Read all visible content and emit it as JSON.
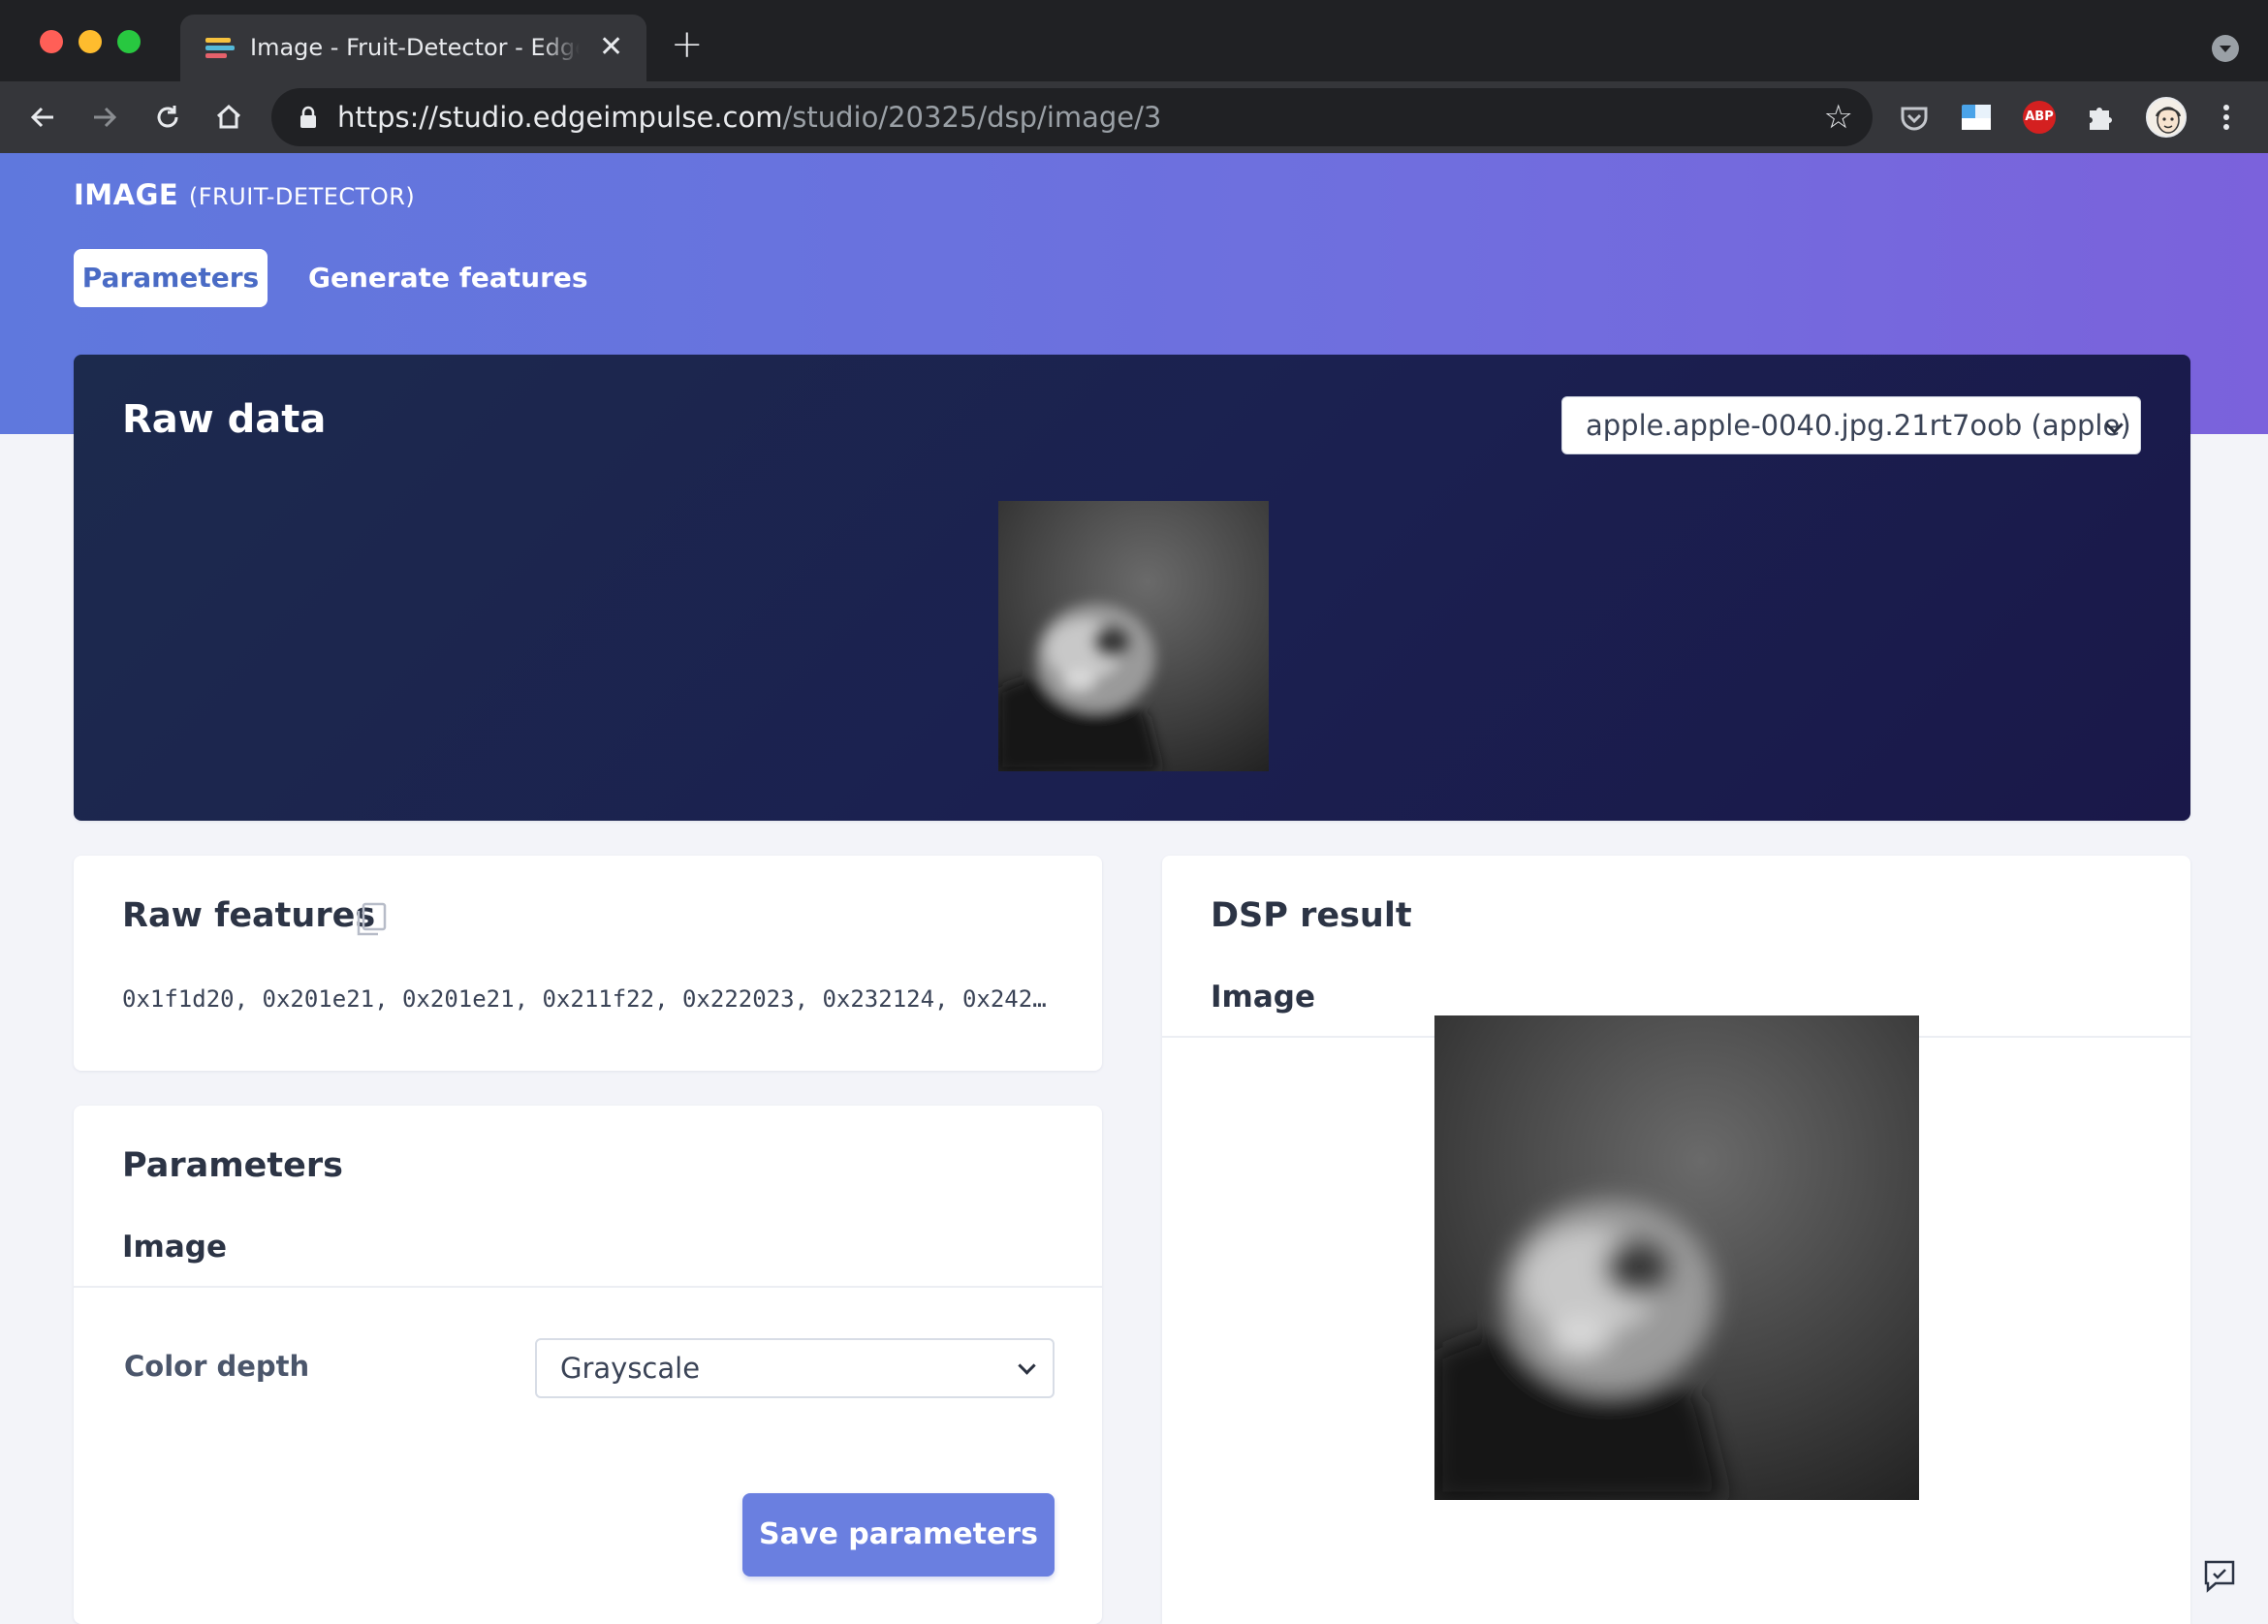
{
  "browser": {
    "tab_title": "Image - Fruit-Detector - Edge Impulse",
    "tab_close": "✕",
    "new_tab": "+",
    "url_host": "https://studio.edgeimpulse.com",
    "url_path": "/studio/20325/dsp/image/3",
    "extensions": [
      "pocket-icon",
      "screenshot-icon",
      "adblock-plus-icon",
      "puzzle-icon",
      "profile-avatar-icon"
    ],
    "adblock_label": "ABP"
  },
  "header": {
    "block_title": "IMAGE",
    "block_subtitle": "(FRUIT-DETECTOR)",
    "tabs": [
      {
        "label": "Parameters",
        "active": true
      },
      {
        "label": "Generate features",
        "active": false
      }
    ]
  },
  "raw_data": {
    "title": "Raw data",
    "selected_sample": "apple.apple-0040.jpg.21rt7oob (apple)"
  },
  "raw_features": {
    "title": "Raw features",
    "values": "0x1f1d20, 0x201e21, 0x201e21, 0x211f22, 0x222023, 0x232124, 0x242…"
  },
  "parameters": {
    "title": "Parameters",
    "section": "Image",
    "color_depth_label": "Color depth",
    "color_depth_value": "Grayscale",
    "save_label": "Save parameters"
  },
  "dsp_result": {
    "title": "DSP result",
    "section": "Image"
  },
  "colors": {
    "hero_gradient_start": "#5f78dd",
    "hero_gradient_end": "#7b62dc",
    "raw_card_bg": "#1b2050",
    "primary_button": "#6a7fe0",
    "active_tab_text": "#4a6bc5"
  }
}
